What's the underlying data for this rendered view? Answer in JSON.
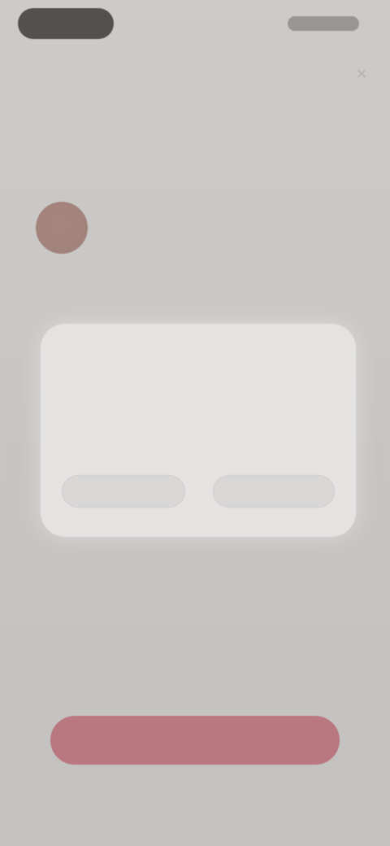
{
  "status_bar": {
    "time": "",
    "icons": [
      "signal-icon",
      "wifi-icon",
      "battery-icon"
    ]
  },
  "header": {
    "close_icon": "close-icon",
    "title": "",
    "subtitle": ""
  },
  "profile": {
    "name": ""
  },
  "main": {
    "description": "",
    "small_text": "",
    "terms": "",
    "cta_label": "",
    "footer_link": ""
  },
  "dialog": {
    "title": "",
    "body": "",
    "left_button": "",
    "right_button": ""
  },
  "colors": {
    "background": "#c7c5c3",
    "dialog": "#e4e3e2",
    "cta": "#b8737b",
    "avatar": "#a47e76"
  }
}
